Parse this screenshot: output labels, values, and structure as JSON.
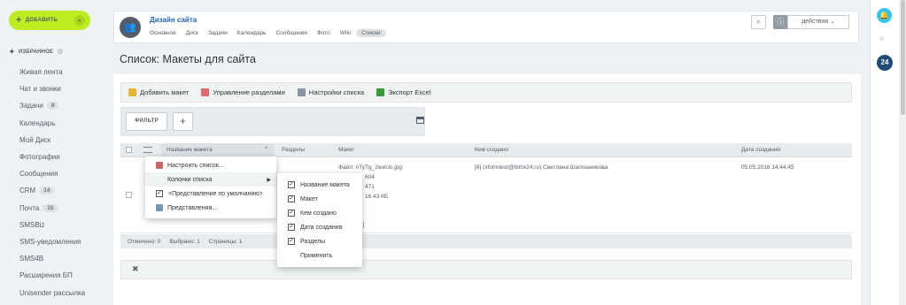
{
  "sidebar": {
    "add_button": "ДОБАВИТЬ",
    "favorites_header": "ИЗБРАННОЕ",
    "items": [
      {
        "label": "Живая лента"
      },
      {
        "label": "Чат и звонки"
      },
      {
        "label": "Задачи",
        "counter": "8"
      },
      {
        "label": "Календарь"
      },
      {
        "label": "Мой Диск"
      },
      {
        "label": "Фотографии"
      },
      {
        "label": "Сообщения"
      },
      {
        "label": "CRM",
        "counter": "14"
      },
      {
        "label": "Почта",
        "counter": "15"
      },
      {
        "label": "SMSBiz"
      },
      {
        "label": "SMS-уведомления"
      },
      {
        "label": "SMS4B"
      },
      {
        "label": "Расширения БП"
      },
      {
        "label": "Unisender рассылка"
      }
    ]
  },
  "group": {
    "title": "Дизайн сайта",
    "tabs": [
      "Основное",
      "Диск",
      "Задачи",
      "Календарь",
      "Сообщения",
      "Фото",
      "Wiki",
      "Списки"
    ],
    "actions_label": "действия"
  },
  "page_title": "Список: Макеты для сайта",
  "toolbar": {
    "add": "Добавить макет",
    "sections": "Управление разделами",
    "settings": "Настройки списка",
    "export": "Экспорт Excel"
  },
  "filter": {
    "button": "ФИЛЬТР",
    "plus": "+"
  },
  "table": {
    "columns": [
      "Название макета",
      "Разделы",
      "Макет",
      "Кем создано",
      "Дата создания"
    ],
    "rows": [
      {
        "file_line1": "Файл: nTyTg_2weUo.jpg",
        "file_line2": "604",
        "file_line3": "471",
        "file_line4": "16.43 КБ",
        "file_line5": "[...]",
        "author": "[8] (xformtest@bitrix24.ru) Светлана Шапошникова",
        "date": "05.05.2016 14:44:45"
      }
    ]
  },
  "footer": {
    "marked": "Отмечено: 0",
    "selected": "Выбрано: 1",
    "pages": "Страницы: 1"
  },
  "context_menu": {
    "items": [
      "Настроить список...",
      "Колонки списка",
      "<Представление по умолчанию>",
      "Представления..."
    ]
  },
  "columns_submenu": {
    "items": [
      "Название макета",
      "Макет",
      "Кем создано",
      "Дата создания",
      "Разделы"
    ],
    "apply": "Применить"
  },
  "right_panel": {
    "badge": "24"
  }
}
